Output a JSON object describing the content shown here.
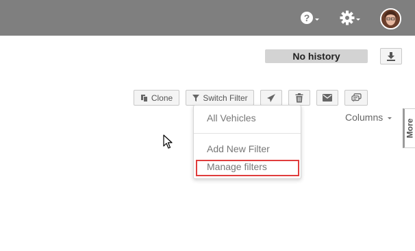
{
  "topbar": {
    "help_icon": "question-circle-icon",
    "settings_icon": "gear-icon",
    "avatar": "user-avatar",
    "background_color": "#7f7f7f"
  },
  "history": {
    "label": "No history"
  },
  "download": {
    "icon": "download-icon"
  },
  "toolbar": {
    "clone_label": "Clone",
    "switch_filter_label": "Switch Filter",
    "icons": [
      "copy-icon",
      "filter-icon",
      "send-icon",
      "trash-icon",
      "envelope-icon",
      "comments-icon"
    ]
  },
  "columns": {
    "label": "Columns"
  },
  "side_tab": {
    "label": "More"
  },
  "filter_menu": {
    "items": [
      {
        "label": "All Vehicles"
      },
      {
        "label": "Add New Filter"
      },
      {
        "label": "Manage filters"
      }
    ],
    "highlight_color": "#e03c3c"
  }
}
